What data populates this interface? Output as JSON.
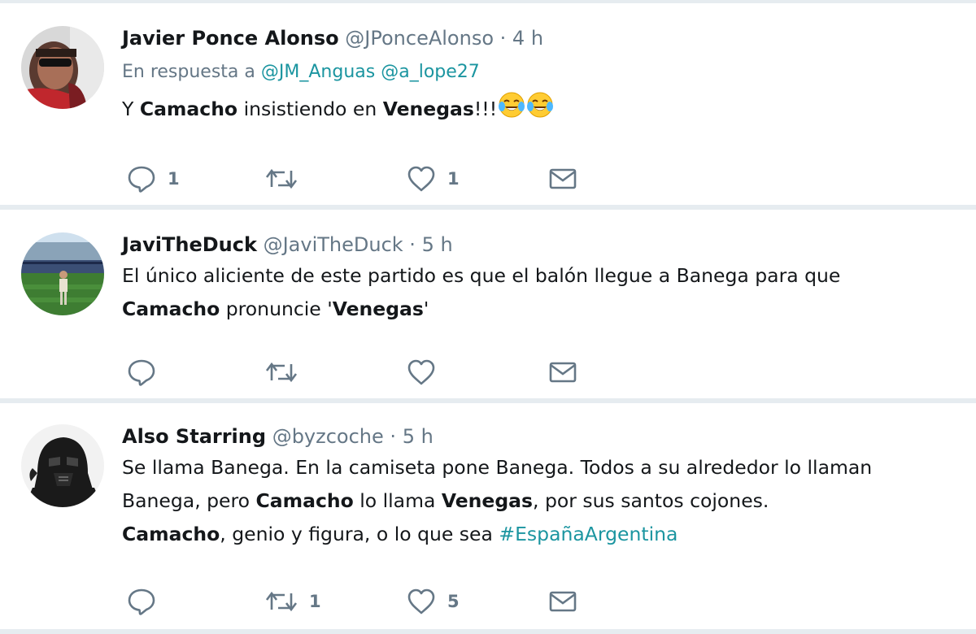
{
  "tweets": [
    {
      "name": "Javier Ponce Alonso",
      "handle": "@JPonceAlonso",
      "time": "4 h",
      "reply_prefix": "En respuesta a",
      "mentions": [
        "@JM_Anguas",
        "@a_lope27"
      ],
      "text": {
        "p1": "Y ",
        "b1": "Camacho",
        "p2": " insistiendo en ",
        "b2": "Venegas",
        "p3": "!!!",
        "emojis": [
          "face-with-tears-of-joy-icon",
          "face-with-tears-of-joy-icon"
        ]
      },
      "actions": {
        "replies": "1",
        "retweets": "",
        "likes": "1"
      },
      "avatar": "red-shirt-sunglasses"
    },
    {
      "name": "JaviTheDuck",
      "handle": "@JaviTheDuck",
      "time": "5 h",
      "text": {
        "p1": "El único aliciente de este partido es que el balón llegue a Banega para que",
        "b1": "Camacho",
        "p2": " pronuncie '",
        "b2": "Venegas",
        "p3": "'"
      },
      "actions": {
        "replies": "",
        "retweets": "",
        "likes": ""
      },
      "avatar": "stadium-pitch"
    },
    {
      "name": "Also Starring",
      "handle": "@byzcoche",
      "time": "5 h",
      "text": {
        "p1": "Se llama Banega. En la camiseta pone Banega. Todos a su alrededor lo llaman",
        "p2": "Banega, pero ",
        "b1": "Camacho",
        "p3": " lo llama ",
        "b2": "Venegas",
        "p4": ", por sus santos cojones.",
        "b3": "Camacho",
        "p5": ", genio y figura, o lo que sea ",
        "hashtag": "#EspañaArgentina"
      },
      "actions": {
        "replies": "",
        "retweets": "1",
        "likes": "5"
      },
      "avatar": "darth-vader"
    }
  ],
  "separator": "·",
  "colors": {
    "text": "#14171a",
    "secondary": "#657786",
    "link": "#1b95a0",
    "separator": "#e6ecf0"
  }
}
